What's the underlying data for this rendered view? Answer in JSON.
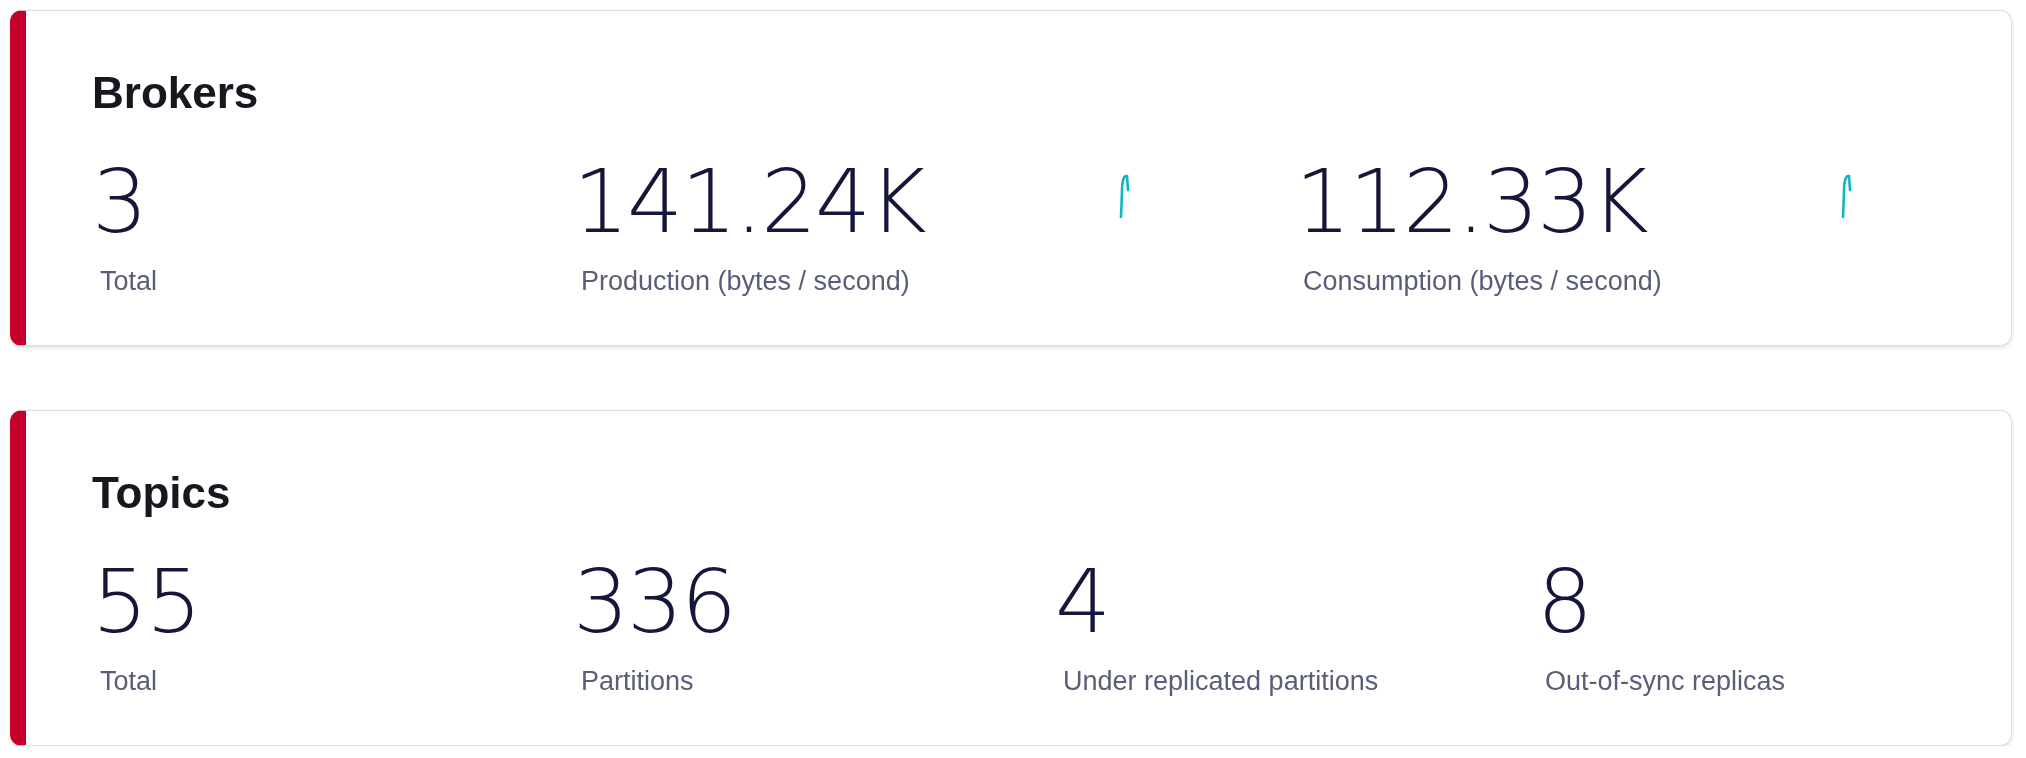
{
  "sections": [
    {
      "title": "Brokers",
      "metrics": [
        {
          "kind": "plain",
          "value": "3",
          "label": "Total"
        },
        {
          "kind": "trend",
          "value": "141.24K",
          "label": "Production (bytes / second)"
        },
        {
          "kind": "trend",
          "value": "112.33K",
          "label": "Consumption (bytes / second)"
        }
      ]
    },
    {
      "title": "Topics",
      "metrics": [
        {
          "kind": "plain",
          "value": "55",
          "label": "Total"
        },
        {
          "kind": "plain",
          "value": "336",
          "label": "Partitions"
        },
        {
          "kind": "plain",
          "value": "4",
          "label": "Under replicated partitions"
        },
        {
          "kind": "plain",
          "value": "8",
          "label": "Out-of-sync replicas"
        }
      ]
    }
  ]
}
